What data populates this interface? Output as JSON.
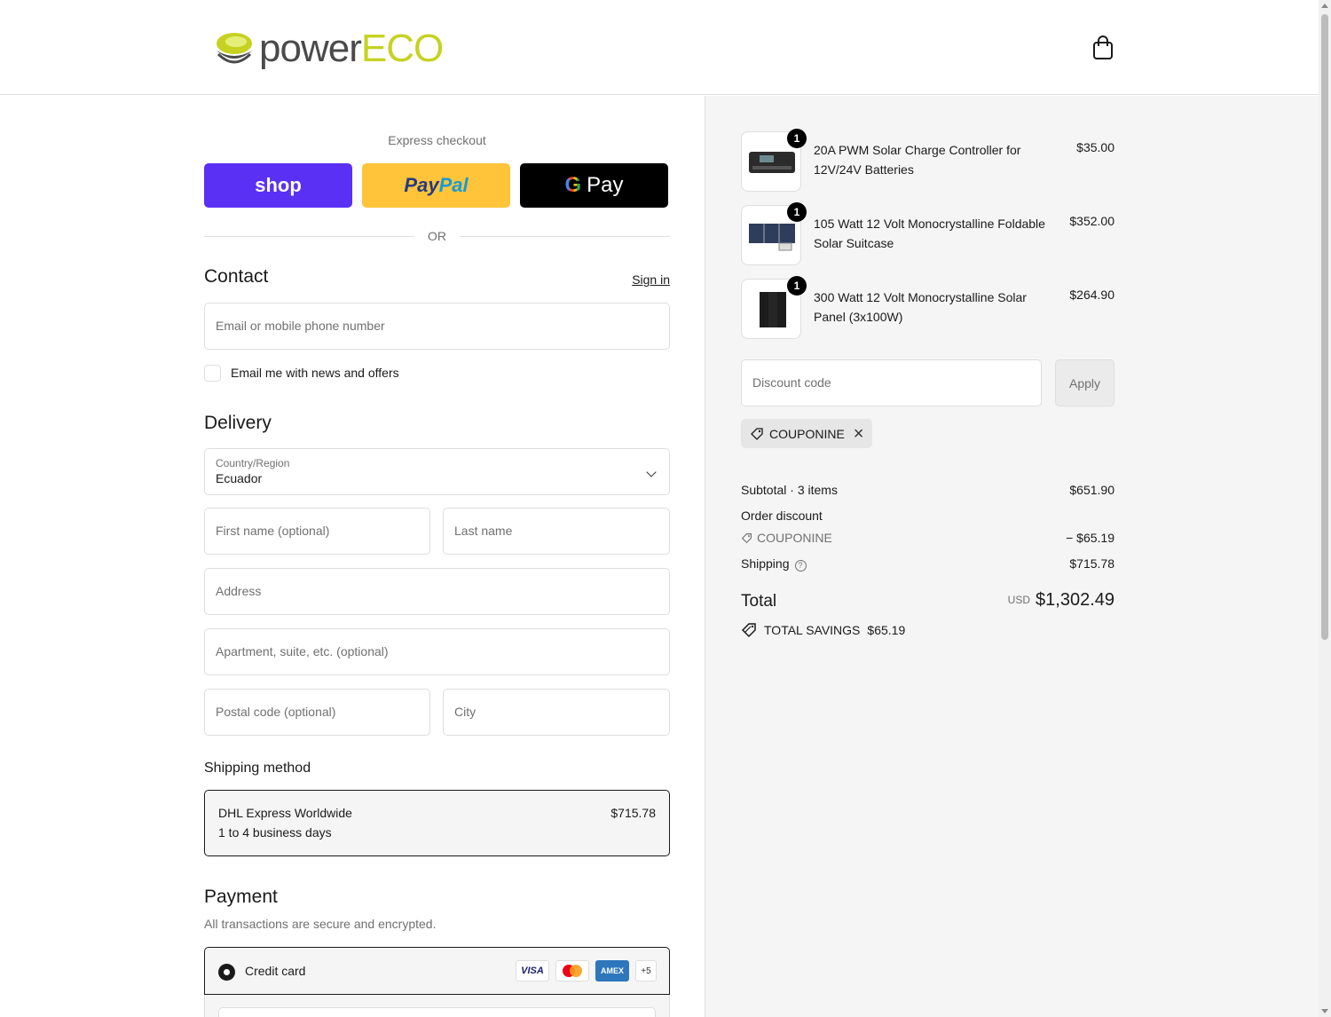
{
  "header": {
    "logo_text_1": "power",
    "logo_text_2": "ECO"
  },
  "express": {
    "label": "Express checkout",
    "shop_label": "shop",
    "paypal_label_1": "Pay",
    "paypal_label_2": "Pal",
    "gpay_g": "G",
    "gpay_label": "Pay",
    "or_label": "OR"
  },
  "contact": {
    "title": "Contact",
    "signin": "Sign in",
    "email_placeholder": "Email or mobile phone number",
    "news_label": "Email me with news and offers"
  },
  "delivery": {
    "title": "Delivery",
    "country_label": "Country/Region",
    "country_value": "Ecuador",
    "first_name": "First name (optional)",
    "last_name": "Last name",
    "address": "Address",
    "apartment": "Apartment, suite, etc. (optional)",
    "postal": "Postal code (optional)",
    "city": "City"
  },
  "shipping": {
    "title": "Shipping method",
    "name": "DHL Express Worldwide",
    "days": "1 to 4 business days",
    "price": "$715.78"
  },
  "payment": {
    "title": "Payment",
    "subtitle": "All transactions are secure and encrypted.",
    "method": "Credit card",
    "cards": [
      "VISA",
      "AMEX",
      "+5"
    ]
  },
  "items": [
    {
      "qty": "1",
      "name": "20A PWM Solar Charge Controller for 12V/24V Batteries",
      "price": "$35.00"
    },
    {
      "qty": "1",
      "name": "105 Watt 12 Volt Monocrystalline Foldable Solar Suitcase",
      "price": "$352.00"
    },
    {
      "qty": "1",
      "name": "300 Watt 12 Volt Monocrystalline Solar Panel (3x100W)",
      "price": "$264.90"
    }
  ],
  "discount": {
    "placeholder": "Discount code",
    "apply": "Apply",
    "code": "COUPONINE"
  },
  "summary": {
    "subtotal_label": "Subtotal · 3 items",
    "subtotal": "$651.90",
    "order_discount_label": "Order discount",
    "discount_code": "COUPONINE",
    "discount_amount": "− $65.19",
    "shipping_label": "Shipping",
    "shipping": "$715.78",
    "total_label": "Total",
    "currency": "USD",
    "total": "$1,302.49",
    "savings_label": "TOTAL SAVINGS",
    "savings": "$65.19"
  },
  "colors": {
    "shop": "#5a31f4",
    "paypal": "#ffc439",
    "gpay": "#000000",
    "logo_green": "#c6d222"
  }
}
